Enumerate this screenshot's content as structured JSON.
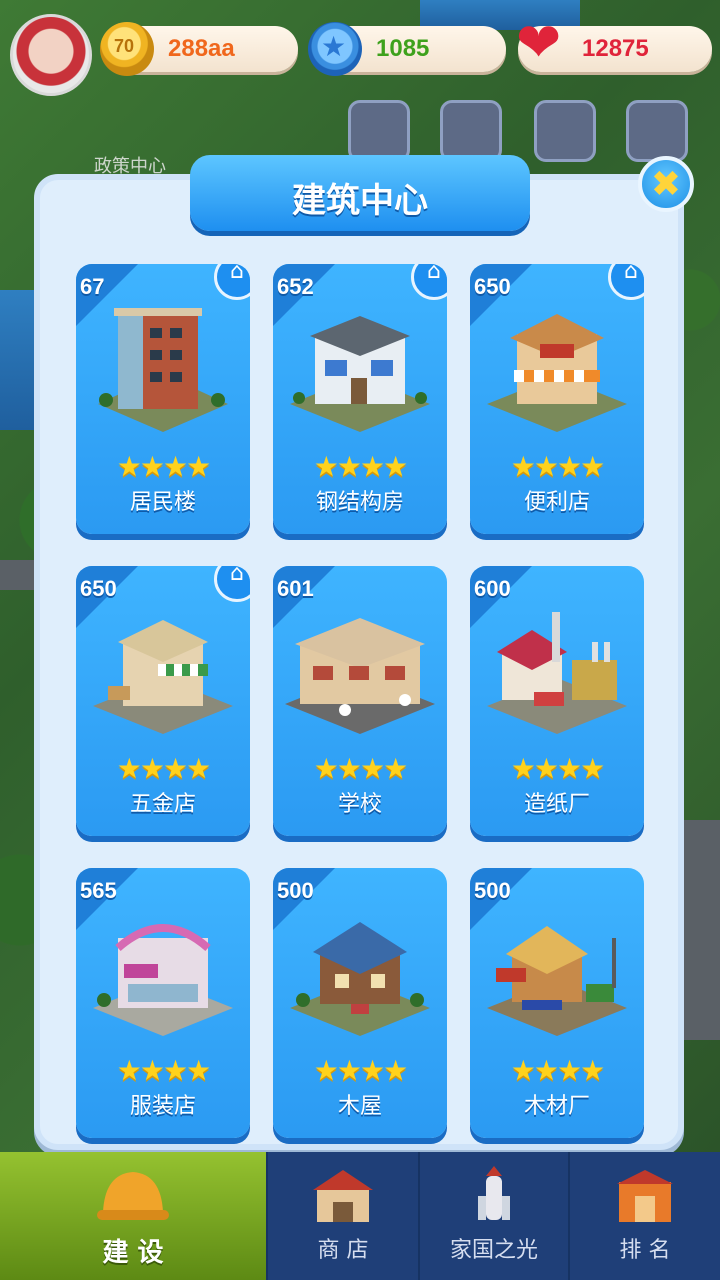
{
  "resources": {
    "coins": "288aa",
    "coins_icon": "coin-70-icon",
    "stars": "1085",
    "stars_icon": "blue-star-icon",
    "hearts": "12875",
    "hearts_icon": "heart-icon"
  },
  "map_label": "政策中心",
  "panel": {
    "title": "建筑中心",
    "close_icon": "close-x-icon"
  },
  "buildings": [
    {
      "num": "67",
      "name": "居民楼",
      "stars": "★★★★",
      "home_badge": true
    },
    {
      "num": "652",
      "name": "钢结构房",
      "stars": "★★★★",
      "home_badge": true
    },
    {
      "num": "650",
      "name": "便利店",
      "stars": "★★★★",
      "home_badge": true
    },
    {
      "num": "650",
      "name": "五金店",
      "stars": "★★★★",
      "home_badge": true
    },
    {
      "num": "601",
      "name": "学校",
      "stars": "★★★★",
      "home_badge": false
    },
    {
      "num": "600",
      "name": "造纸厂",
      "stars": "★★★★",
      "home_badge": false
    },
    {
      "num": "565",
      "name": "服装店",
      "stars": "★★★★",
      "home_badge": false
    },
    {
      "num": "500",
      "name": "木屋",
      "stars": "★★★★",
      "home_badge": false
    },
    {
      "num": "500",
      "name": "木材厂",
      "stars": "★★★★",
      "home_badge": false
    }
  ],
  "bottom_tabs": [
    {
      "label": "建 设",
      "icon": "hardhat-icon",
      "active": true
    },
    {
      "label": "商 店",
      "icon": "shop-icon",
      "active": false
    },
    {
      "label": "家国之光",
      "icon": "rocket-icon",
      "active": false
    },
    {
      "label": "排 名",
      "icon": "ranking-icon",
      "active": false
    }
  ],
  "colors": {
    "accent_blue": "#2b9af2",
    "star_gold": "#ffd21c",
    "active_tab": "#7fae22"
  }
}
